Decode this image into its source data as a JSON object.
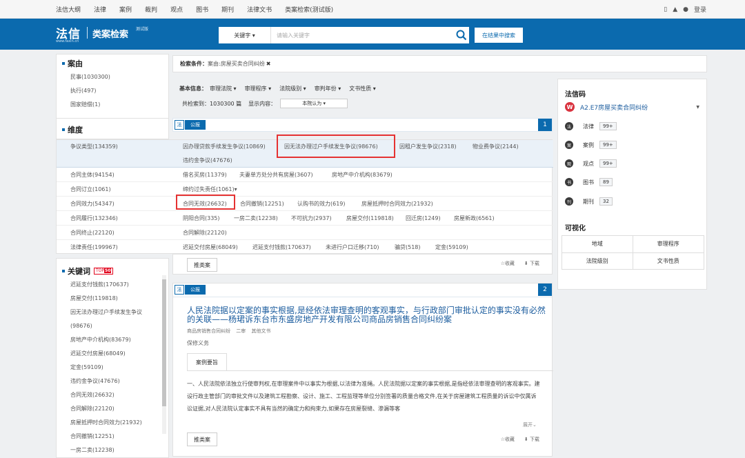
{
  "topnav": {
    "items": [
      "法信大纲",
      "法律",
      "案例",
      "裁判",
      "观点",
      "图书",
      "期刊",
      "法律文书",
      "类案检索(测试版)"
    ],
    "login": "登录"
  },
  "header": {
    "logo_main": "法信",
    "logo_url": "www.faxin.cn",
    "logo_sub": "类案检索",
    "logo_test": "测试版",
    "search_type": "关键字",
    "search_placeholder": "请输入关键字",
    "search_in_results": "在结果中搜索"
  },
  "left": {
    "case_section": {
      "title": "案由",
      "items": [
        "民事(1030300)",
        "执行(497)",
        "国家赔偿(1)"
      ]
    },
    "dim_title": "维度",
    "kw_section": {
      "title": "关键词",
      "top_label": "TOP",
      "top_num": "50",
      "items": [
        "迟延支付钱款(170637)",
        "房屋交付(119818)",
        "因无法办理过户手续发生争议",
        "(98676)",
        "房地产中介机构(83679)",
        "迟延交付房屋(68049)",
        "定金(59109)",
        "违约金争议(47676)",
        "合同无效(26632)",
        "合同解除(22120)",
        "房屋抵押时合同效力(21932)",
        "合同撤销(12251)",
        "一房二卖(12238)"
      ]
    }
  },
  "dims": {
    "rows": [
      {
        "label": "争议类型(134359)",
        "values": [
          "因办理贷款手续发生争议(10869)",
          "因无法办理过户手续发生争议(98676)",
          "因租户发生争议(2318)",
          "物业费争议(2144)",
          "违约金争议(47676)"
        ]
      },
      {
        "label": "合同主体(94154)",
        "values": [
          "借名买房(11379)",
          "夫妻单方处分共有房屋(3607)",
          "房地产中介机构(83679)"
        ]
      },
      {
        "label": "合同订立(1061)",
        "values": [
          "缔约过失责任(1061)▾"
        ]
      },
      {
        "label": "合同效力(54347)",
        "values": [
          "合同无效(26632)",
          "合同撤销(12251)",
          "认购书的效力(619)",
          "房屋抵押时合同效力(21932)"
        ]
      },
      {
        "label": "合同履行(132346)",
        "values": [
          "阴阳合同(335)",
          "一房二卖(12238)",
          "不可抗力(2937)",
          "房屋交付(119818)",
          "回迁房(1249)",
          "房屋新政(6561)"
        ]
      },
      {
        "label": "合同终止(22120)",
        "values": [
          "合同解除(22120)"
        ]
      },
      {
        "label": "法律责任(199967)",
        "values": [
          "迟延交付房屋(68049)",
          "迟延支付钱款(170637)",
          "未进行户口迁移(710)",
          "骗贷(518)",
          "定金(59109)"
        ]
      }
    ]
  },
  "conditions": {
    "label": "检索条件：",
    "value": "案由:房屋买卖合同纠纷"
  },
  "filters": {
    "base_label": "基本信息：",
    "items": [
      "审理法院",
      "审理程序",
      "法院级别",
      "审判年份",
      "文书性质"
    ],
    "total_label": "共检索到：1030300 篇",
    "display_label": "显示内容：",
    "display_value": "本院认为"
  },
  "card1": {
    "tag_law": "法",
    "tag_pub": "公报",
    "num": "1",
    "rec_btn": "推类案",
    "fav": "☆收藏",
    "dl": "下载"
  },
  "card2": {
    "tag_law": "法",
    "tag_pub": "公报",
    "num": "2",
    "title": "人民法院据以定案的事实根据,是经依法审理查明的客观事实，与行政部门审批认定的事实没有必然的关联——杨珺诉东台市东盛房地产开发有限公司商品房销售合同纠纷案",
    "meta": [
      "商品房销售合同纠纷",
      "二审",
      "其他文书"
    ],
    "duty": "保修义务",
    "tab": "案例要旨",
    "body": "一、人民法院依法独立行使审判权,在审理案件中以事实为根据,以法律为准绳。人民法院据以定案的事实根据,是指经依法审理查明的客观事实。建设行政主管部门的审批文件以及建筑工程勘察、设计、施工、工程监理等单位分别签署的质量合格文件,在关于房屋建筑工程质量的诉讼中仅属诉讼证据,对人民法院认定事实不具有当然的确定力和拘束力,如果存在房屋裂缝、渗漏等客",
    "expand": "展开",
    "rec_btn": "推类案",
    "fav": "☆收藏",
    "dl": "下载"
  },
  "right": {
    "code_title": "法信码",
    "code_value": "A2.E7房屋买卖合同纠纷",
    "rows": [
      {
        "icon": "法",
        "label": "法律",
        "count": "99+"
      },
      {
        "icon": "案",
        "label": "案例",
        "count": "99+"
      },
      {
        "icon": "观",
        "label": "观点",
        "count": "99+"
      },
      {
        "icon": "书",
        "label": "图书",
        "count": "89"
      },
      {
        "icon": "刊",
        "label": "期刊",
        "count": "32"
      }
    ],
    "vis_title": "可视化",
    "vis_items": [
      "地域",
      "审理程序",
      "法院级别",
      "文书性质"
    ]
  },
  "colors": {
    "brand": "#0b6aae",
    "highlight": "#e53131"
  }
}
